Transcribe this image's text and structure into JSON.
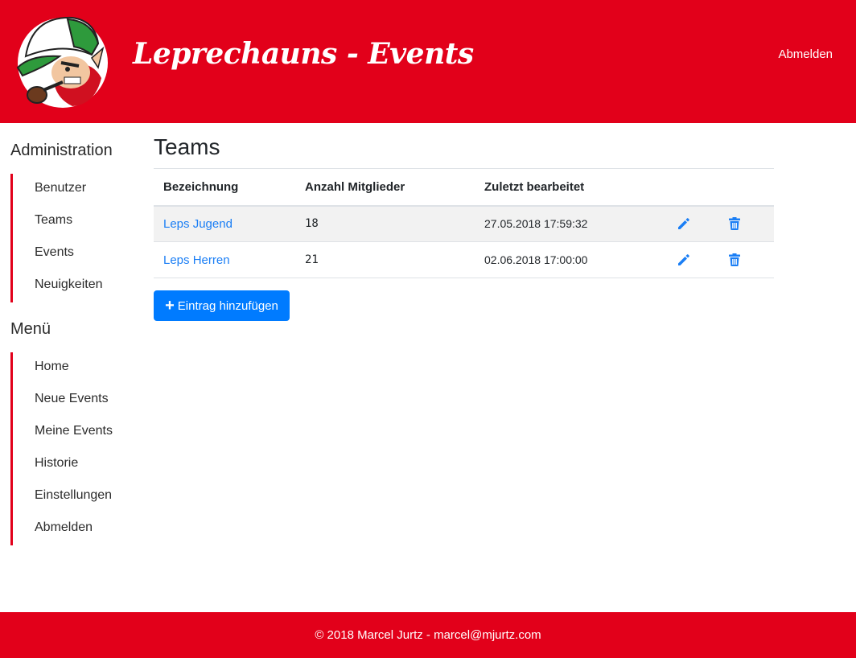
{
  "header": {
    "title": "Leprechauns - Events",
    "logout_label": "Abmelden",
    "logo_icon": "leprechaun-mascot-icon"
  },
  "sidebar": {
    "admin_heading": "Administration",
    "admin_items": [
      {
        "label": "Benutzer"
      },
      {
        "label": "Teams"
      },
      {
        "label": "Events"
      },
      {
        "label": "Neuigkeiten"
      }
    ],
    "menu_heading": "Menü",
    "menu_items": [
      {
        "label": "Home"
      },
      {
        "label": "Neue Events"
      },
      {
        "label": "Meine Events"
      },
      {
        "label": "Historie"
      },
      {
        "label": "Einstellungen"
      },
      {
        "label": "Abmelden"
      }
    ]
  },
  "main": {
    "title": "Teams",
    "table": {
      "columns": [
        "Bezeichnung",
        "Anzahl Mitglieder",
        "Zuletzt bearbeitet"
      ],
      "rows": [
        {
          "name": "Leps Jugend",
          "members": "18",
          "edited": "27.05.2018 17:59:32"
        },
        {
          "name": "Leps Herren",
          "members": "21",
          "edited": "02.06.2018 17:00:00"
        }
      ]
    },
    "add_button_label": "Eintrag hinzufügen"
  },
  "footer": {
    "text": "© 2018 Marcel Jurtz - marcel@mjurtz.com"
  },
  "colors": {
    "brand_red": "#e2001a",
    "link_blue": "#1a7ef5",
    "button_blue": "#007bff"
  }
}
